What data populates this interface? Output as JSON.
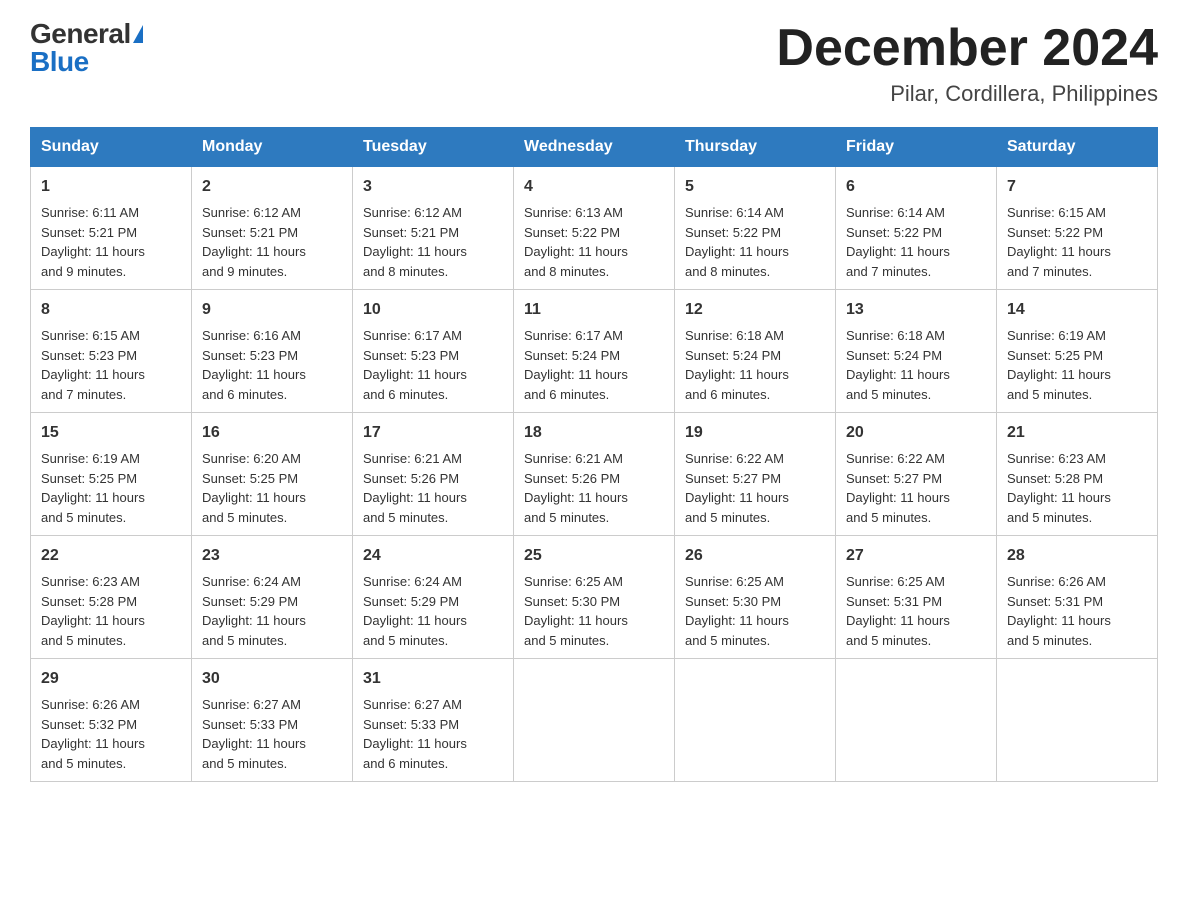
{
  "logo": {
    "general": "General",
    "blue": "Blue"
  },
  "header": {
    "month": "December 2024",
    "location": "Pilar, Cordillera, Philippines"
  },
  "days_of_week": [
    "Sunday",
    "Monday",
    "Tuesday",
    "Wednesday",
    "Thursday",
    "Friday",
    "Saturday"
  ],
  "weeks": [
    [
      {
        "day": "1",
        "sunrise": "6:11 AM",
        "sunset": "5:21 PM",
        "daylight": "11 hours and 9 minutes."
      },
      {
        "day": "2",
        "sunrise": "6:12 AM",
        "sunset": "5:21 PM",
        "daylight": "11 hours and 9 minutes."
      },
      {
        "day": "3",
        "sunrise": "6:12 AM",
        "sunset": "5:21 PM",
        "daylight": "11 hours and 8 minutes."
      },
      {
        "day": "4",
        "sunrise": "6:13 AM",
        "sunset": "5:22 PM",
        "daylight": "11 hours and 8 minutes."
      },
      {
        "day": "5",
        "sunrise": "6:14 AM",
        "sunset": "5:22 PM",
        "daylight": "11 hours and 8 minutes."
      },
      {
        "day": "6",
        "sunrise": "6:14 AM",
        "sunset": "5:22 PM",
        "daylight": "11 hours and 7 minutes."
      },
      {
        "day": "7",
        "sunrise": "6:15 AM",
        "sunset": "5:22 PM",
        "daylight": "11 hours and 7 minutes."
      }
    ],
    [
      {
        "day": "8",
        "sunrise": "6:15 AM",
        "sunset": "5:23 PM",
        "daylight": "11 hours and 7 minutes."
      },
      {
        "day": "9",
        "sunrise": "6:16 AM",
        "sunset": "5:23 PM",
        "daylight": "11 hours and 6 minutes."
      },
      {
        "day": "10",
        "sunrise": "6:17 AM",
        "sunset": "5:23 PM",
        "daylight": "11 hours and 6 minutes."
      },
      {
        "day": "11",
        "sunrise": "6:17 AM",
        "sunset": "5:24 PM",
        "daylight": "11 hours and 6 minutes."
      },
      {
        "day": "12",
        "sunrise": "6:18 AM",
        "sunset": "5:24 PM",
        "daylight": "11 hours and 6 minutes."
      },
      {
        "day": "13",
        "sunrise": "6:18 AM",
        "sunset": "5:24 PM",
        "daylight": "11 hours and 5 minutes."
      },
      {
        "day": "14",
        "sunrise": "6:19 AM",
        "sunset": "5:25 PM",
        "daylight": "11 hours and 5 minutes."
      }
    ],
    [
      {
        "day": "15",
        "sunrise": "6:19 AM",
        "sunset": "5:25 PM",
        "daylight": "11 hours and 5 minutes."
      },
      {
        "day": "16",
        "sunrise": "6:20 AM",
        "sunset": "5:25 PM",
        "daylight": "11 hours and 5 minutes."
      },
      {
        "day": "17",
        "sunrise": "6:21 AM",
        "sunset": "5:26 PM",
        "daylight": "11 hours and 5 minutes."
      },
      {
        "day": "18",
        "sunrise": "6:21 AM",
        "sunset": "5:26 PM",
        "daylight": "11 hours and 5 minutes."
      },
      {
        "day": "19",
        "sunrise": "6:22 AM",
        "sunset": "5:27 PM",
        "daylight": "11 hours and 5 minutes."
      },
      {
        "day": "20",
        "sunrise": "6:22 AM",
        "sunset": "5:27 PM",
        "daylight": "11 hours and 5 minutes."
      },
      {
        "day": "21",
        "sunrise": "6:23 AM",
        "sunset": "5:28 PM",
        "daylight": "11 hours and 5 minutes."
      }
    ],
    [
      {
        "day": "22",
        "sunrise": "6:23 AM",
        "sunset": "5:28 PM",
        "daylight": "11 hours and 5 minutes."
      },
      {
        "day": "23",
        "sunrise": "6:24 AM",
        "sunset": "5:29 PM",
        "daylight": "11 hours and 5 minutes."
      },
      {
        "day": "24",
        "sunrise": "6:24 AM",
        "sunset": "5:29 PM",
        "daylight": "11 hours and 5 minutes."
      },
      {
        "day": "25",
        "sunrise": "6:25 AM",
        "sunset": "5:30 PM",
        "daylight": "11 hours and 5 minutes."
      },
      {
        "day": "26",
        "sunrise": "6:25 AM",
        "sunset": "5:30 PM",
        "daylight": "11 hours and 5 minutes."
      },
      {
        "day": "27",
        "sunrise": "6:25 AM",
        "sunset": "5:31 PM",
        "daylight": "11 hours and 5 minutes."
      },
      {
        "day": "28",
        "sunrise": "6:26 AM",
        "sunset": "5:31 PM",
        "daylight": "11 hours and 5 minutes."
      }
    ],
    [
      {
        "day": "29",
        "sunrise": "6:26 AM",
        "sunset": "5:32 PM",
        "daylight": "11 hours and 5 minutes."
      },
      {
        "day": "30",
        "sunrise": "6:27 AM",
        "sunset": "5:33 PM",
        "daylight": "11 hours and 5 minutes."
      },
      {
        "day": "31",
        "sunrise": "6:27 AM",
        "sunset": "5:33 PM",
        "daylight": "11 hours and 6 minutes."
      },
      null,
      null,
      null,
      null
    ]
  ],
  "labels": {
    "sunrise": "Sunrise:",
    "sunset": "Sunset:",
    "daylight": "Daylight:"
  }
}
